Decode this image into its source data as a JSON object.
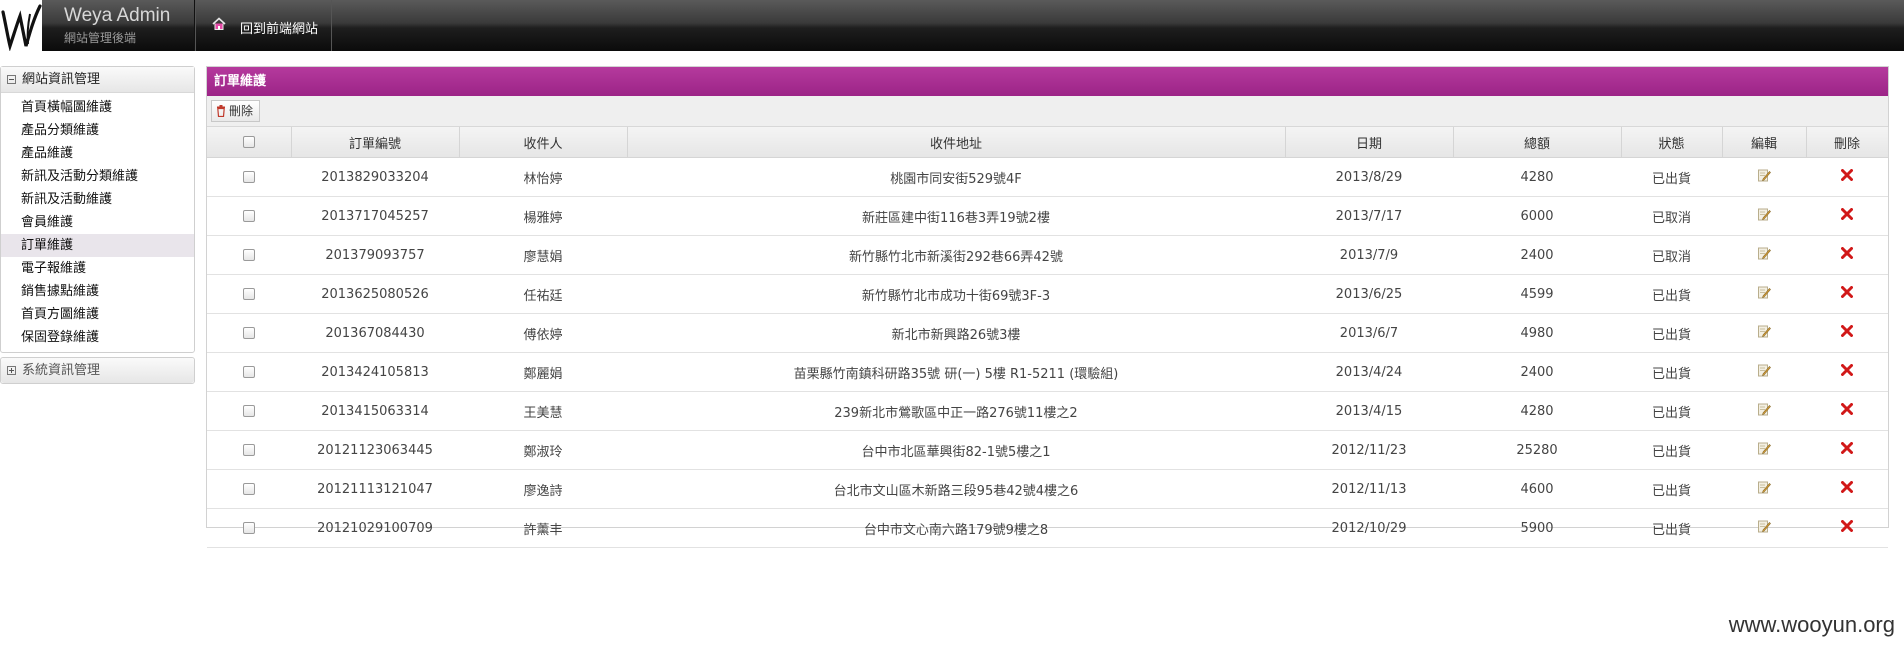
{
  "header": {
    "brand_title": "Weya Admin",
    "brand_subtitle": "網站管理後端",
    "front_link": "回到前端網站"
  },
  "sidebar": {
    "groups": [
      {
        "label": "網站資訊管理",
        "expanded": true,
        "items": [
          {
            "label": "首頁橫幅圖維護"
          },
          {
            "label": "產品分類維護"
          },
          {
            "label": "產品維護"
          },
          {
            "label": "新訊及活動分類維護"
          },
          {
            "label": "新訊及活動維護"
          },
          {
            "label": "會員維護"
          },
          {
            "label": "訂單維護",
            "active": true
          },
          {
            "label": "電子報維護"
          },
          {
            "label": "銷售據點維護"
          },
          {
            "label": "首頁方圖維護"
          },
          {
            "label": "保固登錄維護"
          }
        ]
      },
      {
        "label": "系統資訊管理",
        "expanded": false
      }
    ]
  },
  "main": {
    "panel_title": "訂單維護",
    "delete_button": "刪除",
    "accent_color": "#a62d91",
    "columns": [
      "訂單編號",
      "收件人",
      "收件地址",
      "日期",
      "總額",
      "狀態",
      "編輯",
      "刪除"
    ],
    "rows": [
      {
        "id": "2013829033204",
        "recipient": "林怡婷",
        "address": "桃園市同安街529號4F",
        "date": "2013/8/29",
        "total": "4280",
        "status": "已出貨"
      },
      {
        "id": "2013717045257",
        "recipient": "楊雅婷",
        "address": "新莊區建中街116巷3弄19號2樓",
        "date": "2013/7/17",
        "total": "6000",
        "status": "已取消"
      },
      {
        "id": "201379093757",
        "recipient": "廖慧娟",
        "address": "新竹縣竹北市新溪街292巷66弄42號",
        "date": "2013/7/9",
        "total": "2400",
        "status": "已取消"
      },
      {
        "id": "2013625080526",
        "recipient": "任祐廷",
        "address": "新竹縣竹北市成功十街69號3F-3",
        "date": "2013/6/25",
        "total": "4599",
        "status": "已出貨"
      },
      {
        "id": "201367084430",
        "recipient": "傅依婷",
        "address": "新北市新興路26號3樓",
        "date": "2013/6/7",
        "total": "4980",
        "status": "已出貨"
      },
      {
        "id": "2013424105813",
        "recipient": "鄭麗娟",
        "address": "苗栗縣竹南鎮科研路35號 研(一) 5樓 R1-5211 (環驗組)",
        "date": "2013/4/24",
        "total": "2400",
        "status": "已出貨"
      },
      {
        "id": "2013415063314",
        "recipient": "王美慧",
        "address": "239新北市鶯歌區中正一路276號11樓之2",
        "date": "2013/4/15",
        "total": "4280",
        "status": "已出貨"
      },
      {
        "id": "20121123063445",
        "recipient": "鄭淑玲",
        "address": "台中市北區華興街82-1號5樓之1",
        "date": "2012/11/23",
        "total": "25280",
        "status": "已出貨"
      },
      {
        "id": "20121113121047",
        "recipient": "廖逸詩",
        "address": "台北市文山區木新路三段95巷42號4樓之6",
        "date": "2012/11/13",
        "total": "4600",
        "status": "已出貨"
      },
      {
        "id": "20121029100709",
        "recipient": "許薰丰",
        "address": "台中市文心南六路179號9樓之8",
        "date": "2012/10/29",
        "total": "5900",
        "status": "已出貨"
      }
    ]
  },
  "watermark": "www.wooyun.org"
}
